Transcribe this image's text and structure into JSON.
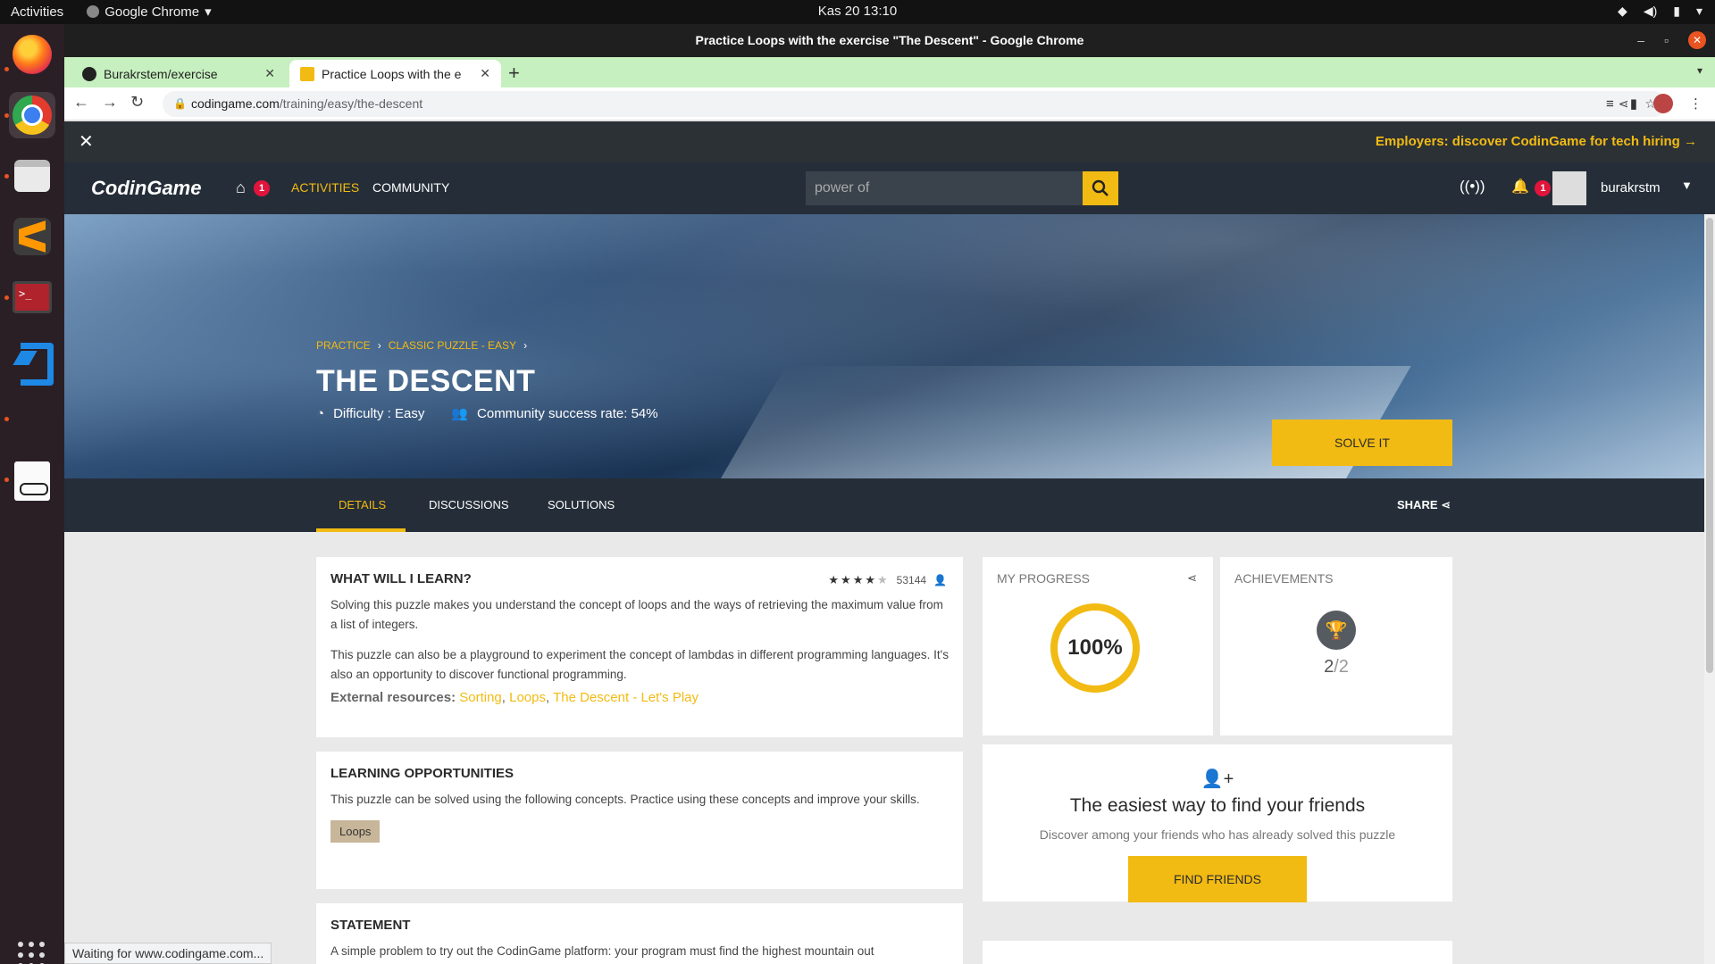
{
  "system": {
    "activities": "Activities",
    "app_name": "Google Chrome",
    "clock": "Kas 20  13:10"
  },
  "window": {
    "title": "Practice Loops with the exercise \"The Descent\" - Google Chrome"
  },
  "tabs": [
    {
      "label": "Burakrstem/exercise",
      "active": false
    },
    {
      "label": "Practice Loops with the e",
      "active": true
    }
  ],
  "address_bar": {
    "domain": "codingame.com",
    "path": "/training/easy/the-descent"
  },
  "banner": {
    "employers_text": "Employers: discover CodinGame for tech hiring →"
  },
  "cg_nav": {
    "logo_left": "Codin",
    "logo_right": "Game",
    "home_badge": "1",
    "activities": "ACTIVITIES",
    "community": "COMMUNITY",
    "search_value": "power of",
    "notif_badge": "1",
    "username": "burakrstm"
  },
  "hero": {
    "breadcrumb": [
      "PRACTICE",
      "CLASSIC PUZZLE - EASY"
    ],
    "title": "THE DESCENT",
    "difficulty": "Difficulty : Easy",
    "success_rate": "Community success rate: 54%",
    "solve_button": "SOLVE IT"
  },
  "subnav": {
    "tabs": [
      "DETAILS",
      "DISCUSSIONS",
      "SOLUTIONS"
    ],
    "share": "SHARE"
  },
  "learn": {
    "title": "WHAT WILL I LEARN?",
    "rating_stars": 4,
    "rating_count": "53144",
    "p1": "Solving this puzzle makes you understand the concept of loops and the ways of retrieving the maximum value from a list of integers.",
    "p2": "This puzzle can also be a playground to experiment the concept of lambdas in different programming languages. It's also an opportunity to discover functional programming.",
    "external_label": "External resources:",
    "resources": [
      "Sorting",
      "Loops",
      "The Descent - Let's Play"
    ]
  },
  "opportunities": {
    "title": "LEARNING OPPORTUNITIES",
    "text": "This puzzle can be solved using the following concepts. Practice using these concepts and improve your skills.",
    "tags": [
      "Loops"
    ]
  },
  "statement": {
    "title": "STATEMENT",
    "text": "A simple problem to try out the CodinGame platform: your program must find the highest mountain out"
  },
  "progress": {
    "label": "MY PROGRESS",
    "value": "100%",
    "fraction": 1.0
  },
  "achievements": {
    "label": "ACHIEVEMENTS",
    "earned": "2",
    "total": "/2"
  },
  "friends": {
    "title": "The easiest way to find your friends",
    "subtitle": "Discover among your friends who has already solved this puzzle",
    "button": "FIND FRIENDS"
  },
  "status_bar": "Waiting for www.codingame.com...",
  "colors": {
    "accent": "#f2bb13",
    "nav_bg": "#252e38",
    "tab_strip": "#c6f0bf"
  }
}
